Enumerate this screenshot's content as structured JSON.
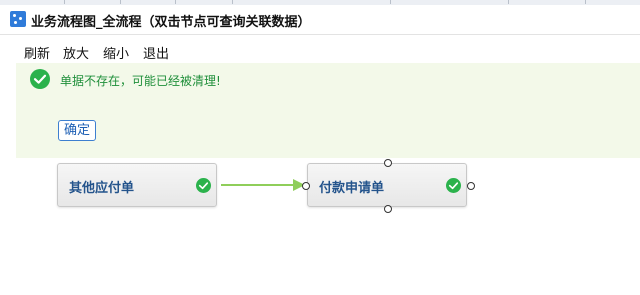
{
  "window": {
    "title": "业务流程图_全流程（双击节点可查询关联数据）",
    "icon": "flowchart-app-icon"
  },
  "menu": {
    "items": [
      {
        "id": "refresh",
        "label": "刷新"
      },
      {
        "id": "zoom_in",
        "label": "放大"
      },
      {
        "id": "zoom_out",
        "label": "缩小"
      },
      {
        "id": "exit",
        "label": "退出"
      }
    ]
  },
  "notice": {
    "message": "单据不存在，可能已经被清理!",
    "confirm_label": "确定",
    "icon": "success-check-icon",
    "colors": {
      "background": "#f3f9e9",
      "text": "#1f8f3a",
      "icon": "#2bb24c"
    }
  },
  "flow": {
    "nodes": [
      {
        "id": "node_payable",
        "label": "其他应付单",
        "status": "completed",
        "status_icon": "check-circle-icon"
      },
      {
        "id": "node_payment_request",
        "label": "付款申请单",
        "status": "completed",
        "status_icon": "check-circle-icon",
        "selected": true
      }
    ],
    "edges": [
      {
        "from": "node_payable",
        "to": "node_payment_request",
        "color": "#8fce5a"
      }
    ],
    "colors": {
      "node_label": "#24548c",
      "status_check": "#2bb24c"
    }
  }
}
